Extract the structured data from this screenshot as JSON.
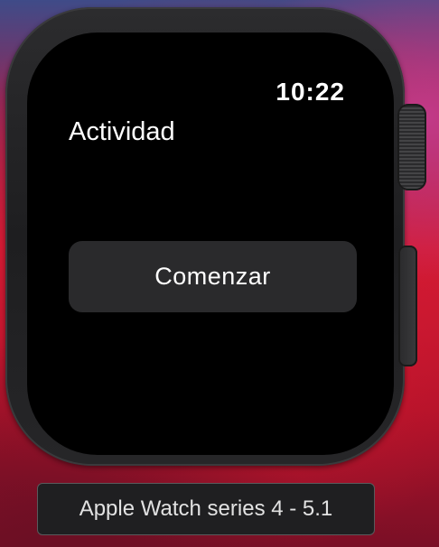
{
  "watch": {
    "time": "10:22",
    "app_title": "Actividad",
    "start_button_label": "Comenzar"
  },
  "device": {
    "label": "Apple Watch series 4 - 5.1"
  },
  "colors": {
    "screen_bg": "#000000",
    "button_bg": "#2a2a2c",
    "text": "#ffffff",
    "case": "#242426"
  }
}
